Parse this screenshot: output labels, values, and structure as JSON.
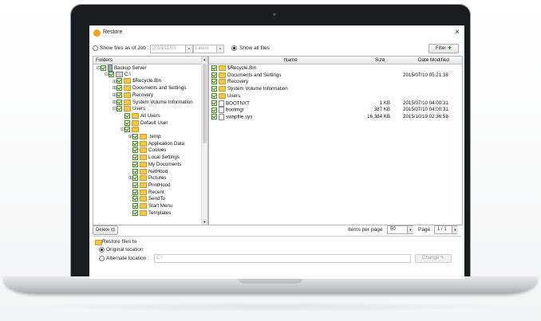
{
  "window": {
    "title": "Restore",
    "close_glyph": "×"
  },
  "options": {
    "show_files_as_of_label": "Show files as of Job :",
    "job_date": "2015/11/03",
    "job_latest": "Latest",
    "show_all_label": "Show all files",
    "filter_label": "Filter"
  },
  "left_panel": {
    "header": "Folders",
    "tree": [
      {
        "label": "Backup Server",
        "indent": 0,
        "exp": "⊟",
        "type": "server"
      },
      {
        "label": "C:\\",
        "indent": 1,
        "exp": "⊟",
        "type": "drive"
      },
      {
        "label": "$Recycle.Bin",
        "indent": 2,
        "exp": "⊞",
        "type": "folder"
      },
      {
        "label": "Documents and Settings",
        "indent": 2,
        "exp": "⊞",
        "type": "folder"
      },
      {
        "label": "Recovery",
        "indent": 2,
        "exp": "⊞",
        "type": "folder"
      },
      {
        "label": "System Volume Information",
        "indent": 2,
        "exp": "⊞",
        "type": "folder"
      },
      {
        "label": "Users",
        "indent": 2,
        "exp": "⊟",
        "type": "folder"
      },
      {
        "label": "All Users",
        "indent": 3,
        "exp": "",
        "type": "folder"
      },
      {
        "label": "Default User",
        "indent": 3,
        "exp": "",
        "type": "folder"
      },
      {
        "label": "",
        "indent": 3,
        "exp": "⊟",
        "type": "folder"
      },
      {
        "label": ".temp",
        "indent": 4,
        "exp": "⊞",
        "type": "folder"
      },
      {
        "label": "Application Data",
        "indent": 4,
        "exp": "",
        "type": "folder"
      },
      {
        "label": "Cookies",
        "indent": 4,
        "exp": "",
        "type": "folder"
      },
      {
        "label": "Local Settings",
        "indent": 4,
        "exp": "",
        "type": "folder"
      },
      {
        "label": "My Documents",
        "indent": 4,
        "exp": "",
        "type": "folder"
      },
      {
        "label": "NetHood",
        "indent": 4,
        "exp": "",
        "type": "folder"
      },
      {
        "label": "Pictures",
        "indent": 4,
        "exp": "⊞",
        "type": "folder"
      },
      {
        "label": "PrintHood",
        "indent": 4,
        "exp": "",
        "type": "folder"
      },
      {
        "label": "Recent",
        "indent": 4,
        "exp": "",
        "type": "folder"
      },
      {
        "label": "SendTo",
        "indent": 4,
        "exp": "",
        "type": "folder"
      },
      {
        "label": "Start Menu",
        "indent": 4,
        "exp": "",
        "type": "folder"
      },
      {
        "label": "Templates",
        "indent": 4,
        "exp": "",
        "type": "folder"
      }
    ]
  },
  "file_list": {
    "headers": {
      "name": "Name",
      "size": "Size",
      "modified": "Date Modified"
    },
    "rows": [
      {
        "name": "$Recycle.Bin",
        "size": "",
        "modified": "",
        "type": "folder"
      },
      {
        "name": "Documents and Settings",
        "size": "",
        "modified": "2015/07/10 05:21:38",
        "type": "folder"
      },
      {
        "name": "Recovery",
        "size": "",
        "modified": "",
        "type": "folder"
      },
      {
        "name": "System Volume Information",
        "size": "",
        "modified": "",
        "type": "folder"
      },
      {
        "name": "Users",
        "size": "",
        "modified": "",
        "type": "folder"
      },
      {
        "name": "BOOTNXT",
        "size": "1 KB",
        "modified": "2015/07/10 04:00:31",
        "type": "file"
      },
      {
        "name": "bootmgr",
        "size": "387 KB",
        "modified": "2015/07/10 04:00:31",
        "type": "file"
      },
      {
        "name": "swapfile.sys",
        "size": "16,384 KB",
        "modified": "2015/10/19 02:36:58",
        "type": "file"
      }
    ]
  },
  "bottom_bar": {
    "delete_label": "Delete",
    "items_per_page_label": "Items per page :",
    "items_per_page": "50",
    "page_label": "Page :",
    "page_value": "1 / 1"
  },
  "restore_to": {
    "title": "Restore files to",
    "original_label": "Original location",
    "alternate_label": "Alternate location :",
    "alternate_path": "C:\\",
    "change_label": "Change"
  }
}
